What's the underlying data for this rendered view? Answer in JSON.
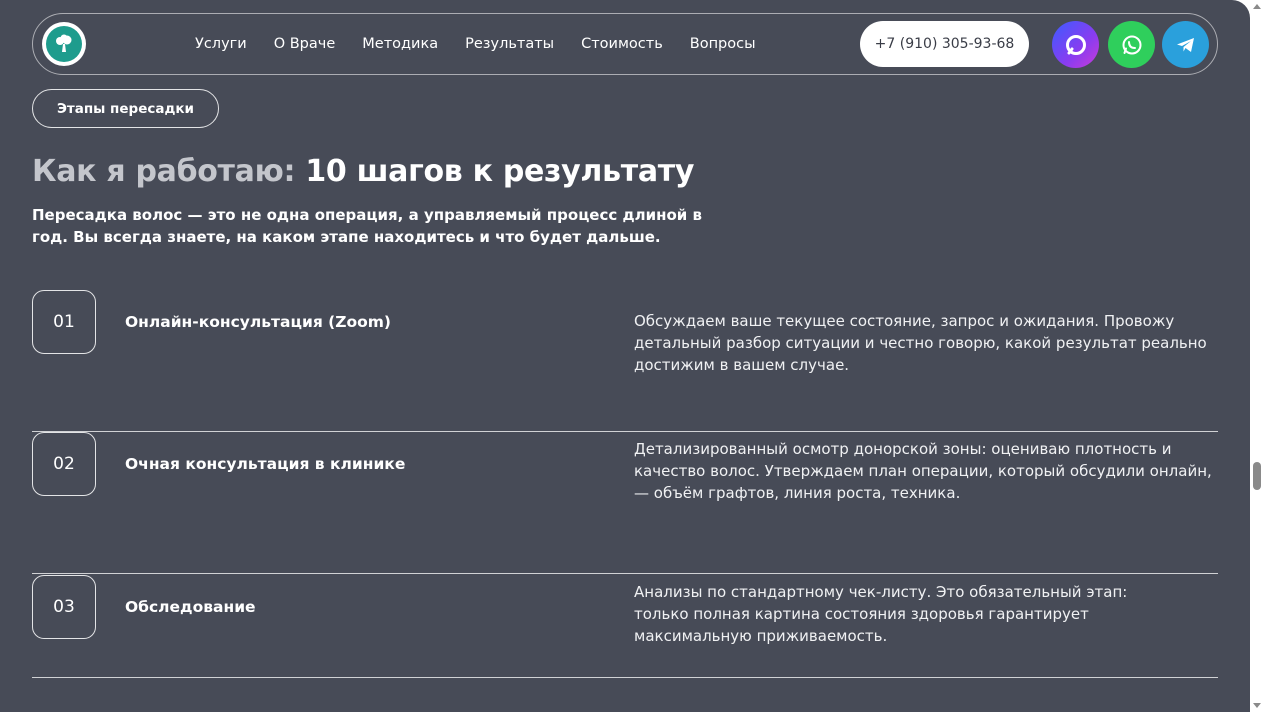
{
  "header": {
    "nav": [
      "Услуги",
      "О Враче",
      "Методика",
      "Результаты",
      "Стоимость",
      "Вопросы"
    ],
    "phone": "+7 (910) 305-93-68",
    "socials": [
      "max-icon",
      "whatsapp-icon",
      "telegram-icon"
    ]
  },
  "section": {
    "tag": "Этапы пересадки",
    "title_muted": "Как я работаю:",
    "title_bright": "10 шагов к результату",
    "subtitle": "Пересадка волос — это не одна операция, а управляемый процесс длиной в год. Вы всегда знаете, на каком этапе находитесь и что будет дальше."
  },
  "steps": [
    {
      "num": "01",
      "title": "Онлайн-консультация (Zoom)",
      "desc": "Обсуждаем ваше текущее состояние, запрос и ожидания. Провожу детальный разбор ситуации и честно говорю, какой результат реально достижим в вашем случае."
    },
    {
      "num": "02",
      "title": "Очная консультация в клинике",
      "desc": "Детализированный осмотр донорской зоны: оцениваю плотность и качество волос. Утверждаем план операции, который обсудили онлайн, — объём графтов, линия роста, техника."
    },
    {
      "num": "03",
      "title": "Обследование",
      "desc": "Анализы по стандартному чек-листу. Это обязательный этап: только полная картина состояния здоровья гарантирует максимальную приживаемость."
    }
  ],
  "colors": {
    "background": "#474b57",
    "accent_logo": "#1e9c8d",
    "whatsapp": "#2fcf5c",
    "telegram": "#2aa0dc"
  }
}
